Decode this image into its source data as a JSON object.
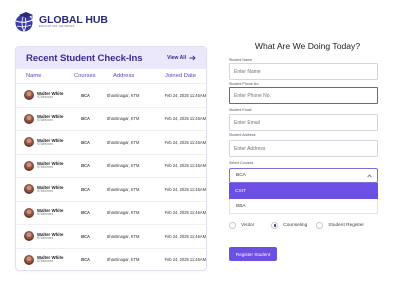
{
  "logo": {
    "name": "GLOBAL HUB",
    "tagline": "EDUCATION NETWORK"
  },
  "panel": {
    "title": "Recent Student Check-Ins",
    "view_all": "View All",
    "columns": [
      "Name",
      "Courses",
      "Address",
      "Joined Date"
    ],
    "rows": [
      {
        "name": "Walter White",
        "phone": "97##xxxxx",
        "course": "BCA",
        "address": "Shantinagar, KTM",
        "date": "Feb 24, 2025 11:45AM"
      },
      {
        "name": "Walter White",
        "phone": "97##xxxxx",
        "course": "BCA",
        "address": "Shantinagar, KTM",
        "date": "Feb 24, 2025 11:45AM"
      },
      {
        "name": "Walter White",
        "phone": "97##xxxxx",
        "course": "BCA",
        "address": "Shantinagar, KTM",
        "date": "Feb 24, 2025 11:45AM"
      },
      {
        "name": "Walter White",
        "phone": "97##xxxxx",
        "course": "BCA",
        "address": "Shantinagar, KTM",
        "date": "Feb 24, 2025 11:45AM"
      },
      {
        "name": "Walter White",
        "phone": "97##xxxxx",
        "course": "BCA",
        "address": "Shantinagar, KTM",
        "date": "Feb 24, 2025 11:45AM"
      },
      {
        "name": "Walter White",
        "phone": "97##xxxxx",
        "course": "BCA",
        "address": "Shantinagar, KTM",
        "date": "Feb 24, 2025 11:45AM"
      },
      {
        "name": "Walter White",
        "phone": "97##xxxxx",
        "course": "BCA",
        "address": "Shantinagar, KTM",
        "date": "Feb 24, 2025 11:45AM"
      },
      {
        "name": "Walter White",
        "phone": "97##xxxxx",
        "course": "BCA",
        "address": "Shantinagar, KTM",
        "date": "Feb 24, 2025 11:45AM"
      },
      {
        "name": "Walter White",
        "phone": "97##xxxxx",
        "course": "BCA",
        "address": "Shantinagar, KTM",
        "date": "Feb 24, 2025 11:45AM"
      }
    ]
  },
  "form": {
    "title": "What Are We Doing Today?",
    "name": {
      "label": "Student Name",
      "placeholder": "Enter Name"
    },
    "phone": {
      "label": "Student Phone No.",
      "placeholder": "Enter Phone No."
    },
    "email": {
      "label": "Student Email",
      "placeholder": "Enter Email"
    },
    "address": {
      "label": "Student Address",
      "placeholder": "Enter Address"
    },
    "courses": {
      "label": "Select Courses",
      "selected": "BCA",
      "options": [
        "CSIT",
        "BBA"
      ]
    },
    "purpose": {
      "options": [
        "Visitor",
        "Counseling",
        "Student Register"
      ],
      "selected": "Counseling"
    },
    "submit": "Register Student"
  },
  "colors": {
    "primary": "#6b50e3",
    "heading": "#3c2c97",
    "header_bg": "#ece8fb",
    "focus_border": "#5a62d9"
  }
}
